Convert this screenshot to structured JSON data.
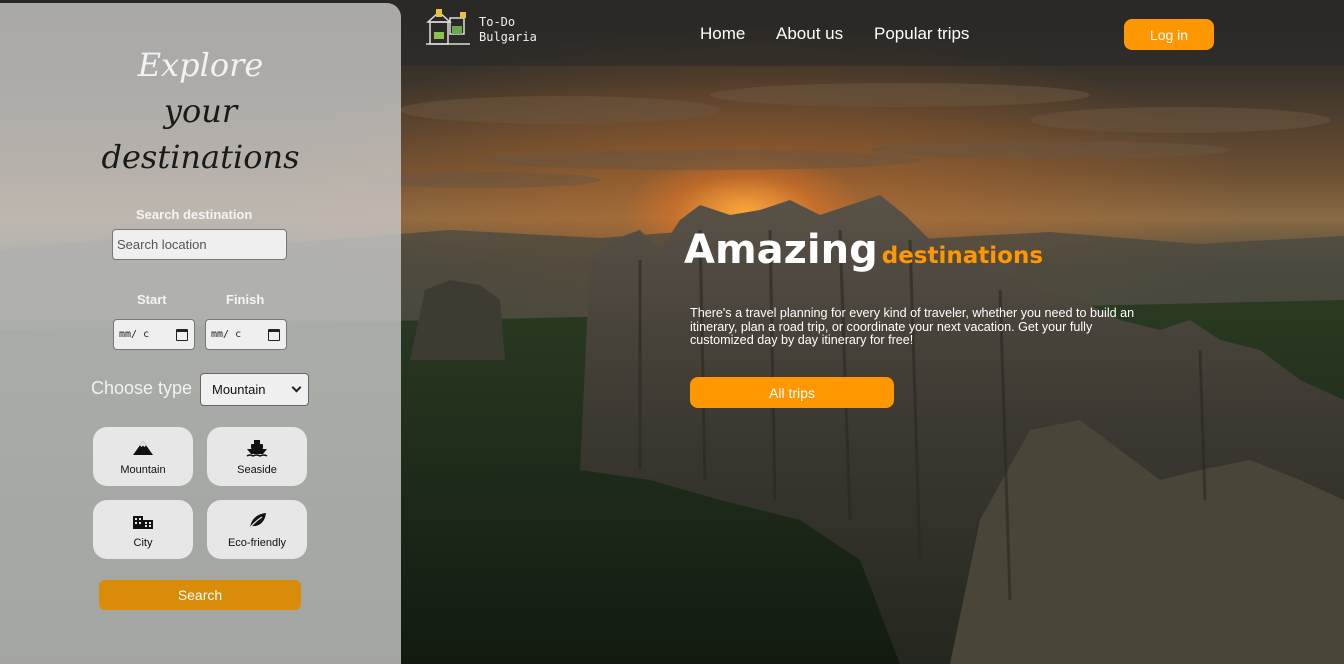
{
  "sidebar": {
    "heading": [
      "Explore",
      "your",
      "destinations"
    ],
    "search_label": "Search destination",
    "search_placeholder": "Search location",
    "start_label": "Start",
    "finish_label": "Finish",
    "start_value": "mm/ c",
    "finish_value": "mm/ c",
    "choose_type_label": "Choose type",
    "type_selected": "Mountain",
    "tiles": [
      {
        "label": "Mountain",
        "icon": "mountain-icon"
      },
      {
        "label": "Seaside",
        "icon": "ship-icon"
      },
      {
        "label": "City",
        "icon": "city-icon"
      },
      {
        "label": "Eco-friendly",
        "icon": "leaf-icon"
      }
    ],
    "search_button": "Search"
  },
  "header": {
    "logo_lines": [
      "To-Do",
      "Bulgaria"
    ],
    "nav": [
      "Home",
      "About us",
      "Popular trips"
    ],
    "login_button": "Log in"
  },
  "hero": {
    "title_big": "Amazing",
    "title_small": "destinations",
    "description": "There's a travel planning for every kind of traveler, whether you need to build an itinerary, plan a road trip, or coordinate your next vacation. Get your fully customized day by day itinerary for free!",
    "cta_button": "All trips"
  },
  "colors": {
    "accent": "#ff9800",
    "search_button": "#d98b0a",
    "sidebar_bg": "#cdcdcd"
  }
}
